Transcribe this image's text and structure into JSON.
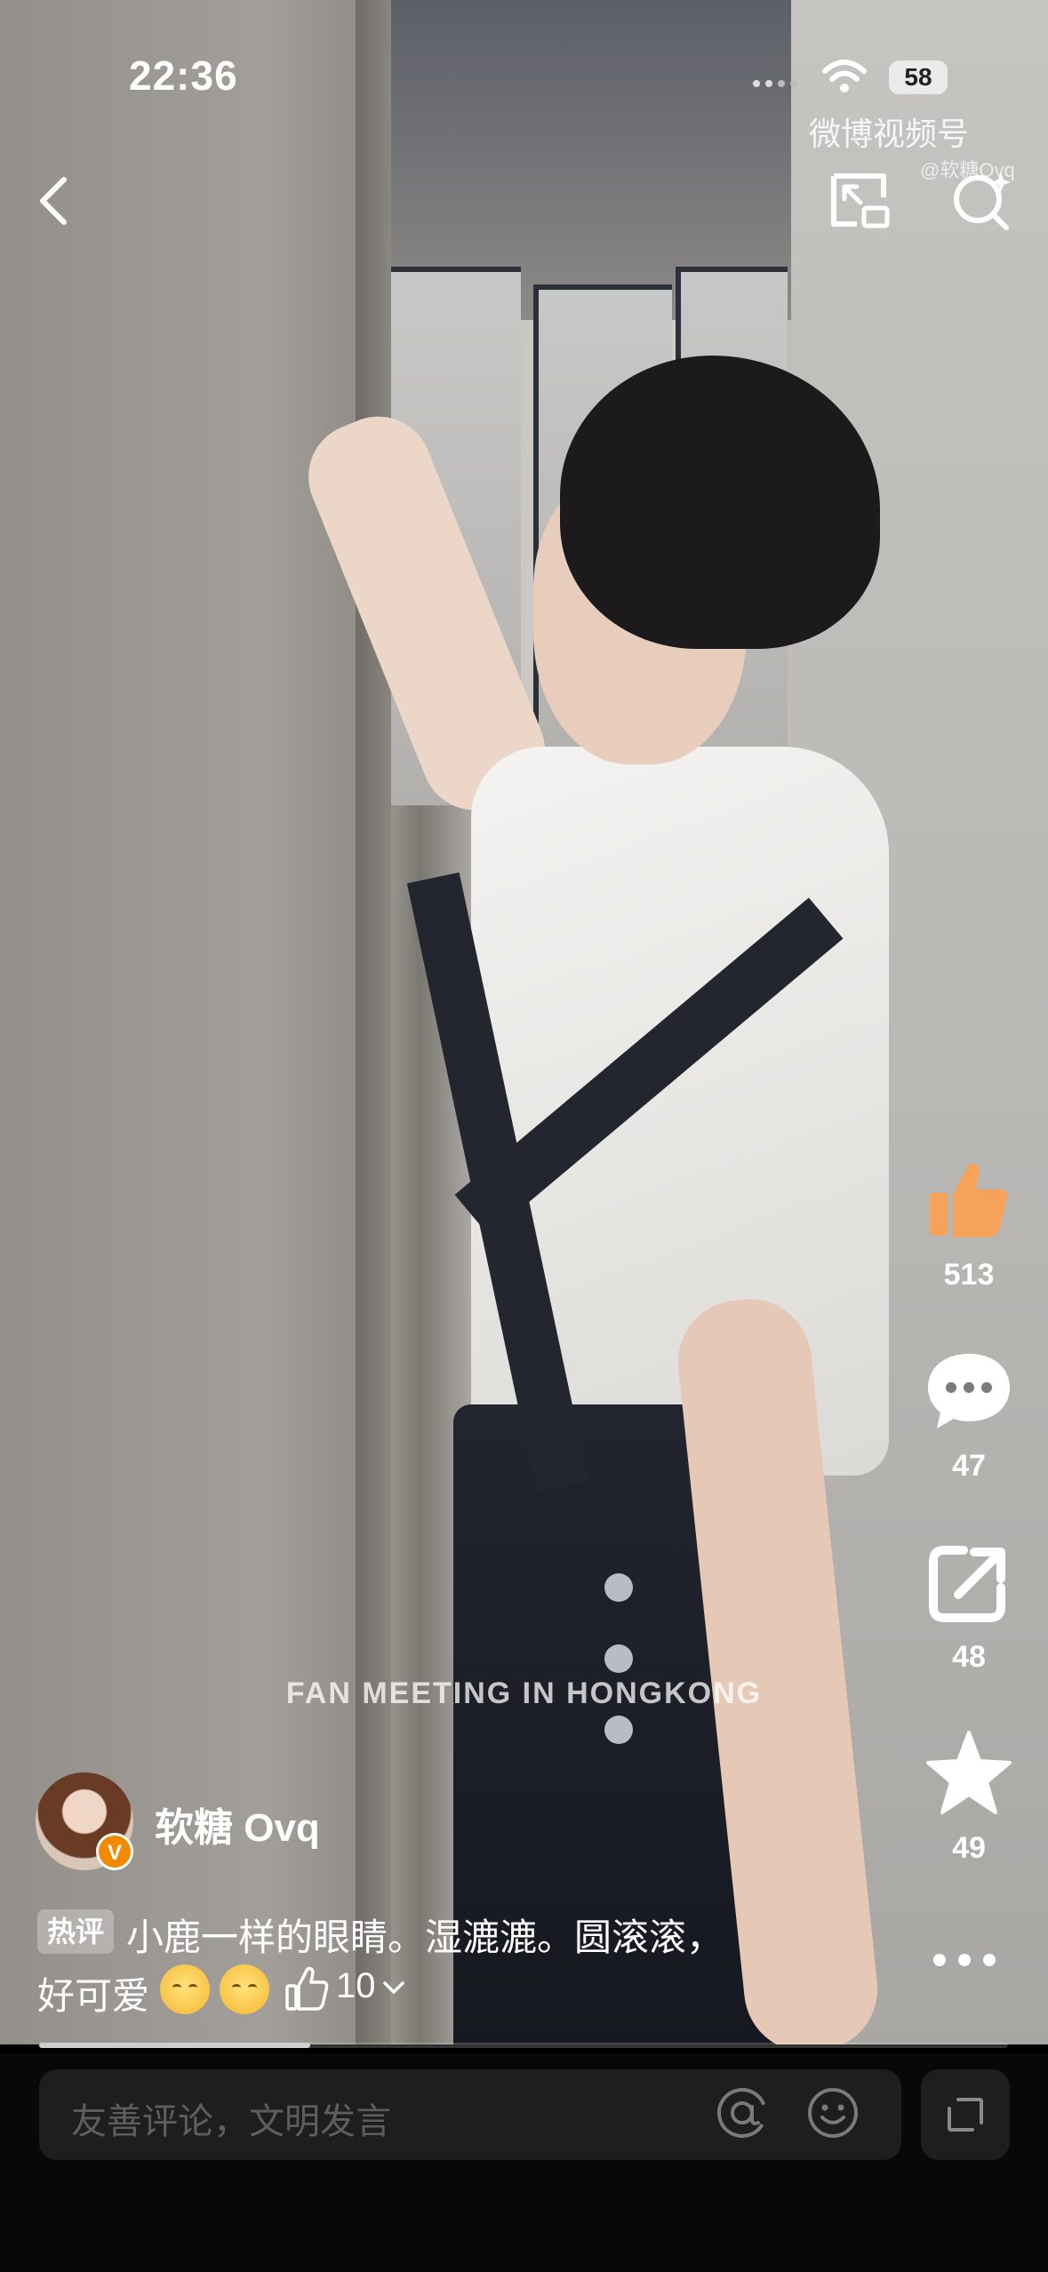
{
  "status_bar": {
    "time": "22:36",
    "battery": "58"
  },
  "watermark": {
    "brand": "微博视频号",
    "handle": "@软糖Ovq"
  },
  "video": {
    "caption": "FAN MEETING IN HONGKONG",
    "progress": 0.28
  },
  "actions": {
    "like_count": "513",
    "comment_count": "47",
    "share_count": "48",
    "favorite_count": "49"
  },
  "author": {
    "name": "软糖 Ovq"
  },
  "hot_comment": {
    "badge": "热评",
    "line1": "小鹿一样的眼睛。湿漉漉。圆滚滚，",
    "line2": "好可爱",
    "likes": "10"
  },
  "comment_input": {
    "placeholder": "友善评论，文明发言"
  },
  "icons": [
    "back-icon",
    "pip-icon",
    "search-icon",
    "thumbs-up-icon",
    "comment-icon",
    "share-icon",
    "star-icon",
    "more-icon",
    "at-icon",
    "emoji-icon",
    "expand-icon"
  ],
  "colors": {
    "like_orange": "#f6a25a",
    "verify_orange": "#f28a00",
    "input_bg": "#1e1e1e",
    "placeholder": "#5e5e5e"
  }
}
